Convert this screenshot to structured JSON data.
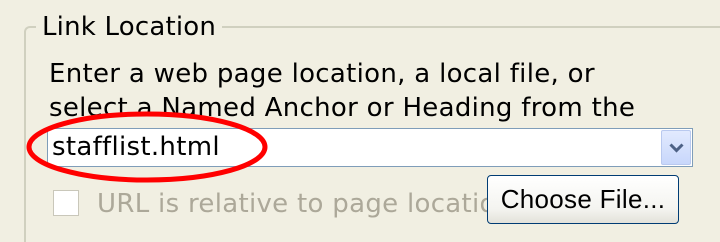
{
  "group": {
    "legend": "Link Location"
  },
  "instructions": "Enter a web page location, a local file, or select a Named Anchor or Heading from the popup list:",
  "location_combo": {
    "value": "stafflist.html",
    "dropdown_icon": "chevron-down-icon"
  },
  "relative_url_checkbox": {
    "label": "URL is relative to page location",
    "checked": false,
    "enabled": false
  },
  "choose_file_button": {
    "label": "Choose File..."
  },
  "annotation": {
    "shape": "ellipse",
    "color": "#ff0000"
  }
}
